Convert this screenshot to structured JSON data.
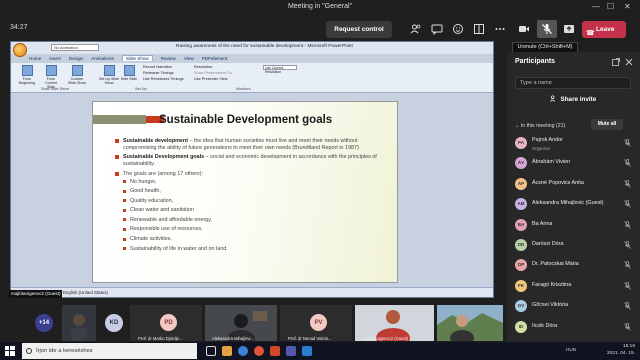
{
  "window": {
    "title": "Meeting in \"General\""
  },
  "toolbar": {
    "timer": "34:27",
    "request_control": "Request control",
    "leave": "Leave",
    "tooltip": "Unmute (Ctrl+Shift+M)"
  },
  "ppt": {
    "doc_title": "Raising awareness of the need for sustainable development - Microsoft PowerPoint",
    "quick_access": "No Animation",
    "tabs": [
      "Home",
      "Insert",
      "Design",
      "Animations",
      "Slide Show",
      "Review",
      "View",
      "PDFelement"
    ],
    "active_tab": "Slide Show",
    "ribbon": {
      "from_beginning": "From Beginning",
      "from_current": "From Current Slide",
      "custom_show": "Custom Slide Show",
      "set_up": "Set Up Slide Show",
      "hide_slide": "Hide Slide",
      "record_narration": "Record Narration",
      "rehearse": "Rehearse Timings",
      "use_timings": "Use Rehearsed Timings",
      "resolution_label": "Resolution:",
      "resolution_value": "Use Current Resolution",
      "show_on": "Show Presentation On:",
      "presenter_view": "Use Presenter View",
      "group_start": "Start Slide Show",
      "group_setup": "Set Up",
      "group_monitors": "Monitors"
    },
    "status_lang": "English (United States)",
    "slide": {
      "title": "Sustainable Development goals",
      "p1_bold": "Sustainable development",
      "p1_text": " – the idea that human societies must live and meet their needs without compromising the ability of future generations to meet their own needs (Brundtland Report in 1987)",
      "p2_bold": "Sustainable Development goals",
      "p2_text": " – social and economic development in accordance with the principles of sustainability.",
      "p3_text": "The goals are (among 17 others):",
      "goals": [
        "No hunger,",
        "Good health,",
        "Quality education,",
        "Clean water and sanitation",
        "Renewable and affordable energy,",
        "Responsible use of resources,",
        "Climate activities,",
        "Sustainability of life in water and on land."
      ]
    }
  },
  "presenter_label": "majkitanigeevc2 (Guest)",
  "participants": {
    "title": "Participants",
    "search_placeholder": "Type a name",
    "share_invite": "Share invite",
    "in_meeting": "In this meeting (21)",
    "mute_all": "Mute all",
    "people": [
      {
        "name": "Pajrok Andor",
        "sub": "Organizer",
        "initials": "PA",
        "color": "#e8b4c8"
      },
      {
        "name": "Ábrahám Vivien",
        "sub": "",
        "initials": "ÁV",
        "color": "#d4a5d6"
      },
      {
        "name": "Ácsné Popovics Anita",
        "sub": "",
        "initials": "ÁP",
        "color": "#f2c28a"
      },
      {
        "name": "Aleksandra Mihajlovic (Guest)",
        "sub": "",
        "initials": "AM",
        "color": "#c7b2e3"
      },
      {
        "name": "Ba Anna",
        "sub": "",
        "initials": "BA",
        "color": "#e3a0b6"
      },
      {
        "name": "Darószi Dóra",
        "sub": "",
        "initials": "DD",
        "color": "#b9d3a6"
      },
      {
        "name": "Dr. Patocskai Mária",
        "sub": "",
        "initials": "DP",
        "color": "#e7a5a5"
      },
      {
        "name": "Faragó Krisztina",
        "sub": "",
        "initials": "FK",
        "color": "#f0c77a"
      },
      {
        "name": "Gőcsei Viktória",
        "sub": "",
        "initials": "GV",
        "color": "#a9cde0"
      },
      {
        "name": "Ilcsik Dóra",
        "sub": "",
        "initials": "ID",
        "color": "#cfe0a2"
      }
    ]
  },
  "videos": {
    "extra_count": "+14",
    "kd_initials": "KD",
    "pd_initials": "PD",
    "pv_initials": "PV",
    "labels": [
      "Prof. dr Marko Djordje...",
      "Aleksandra Mihajlovi...",
      "Prof. dr Nenad Vukmi...",
      "majkitanigeevc2 (Guest)"
    ]
  },
  "taskbar": {
    "search": "Írjon ide a kereséshez",
    "lang": "HUN",
    "time": "16:19",
    "date": "2021. 04. 15."
  }
}
